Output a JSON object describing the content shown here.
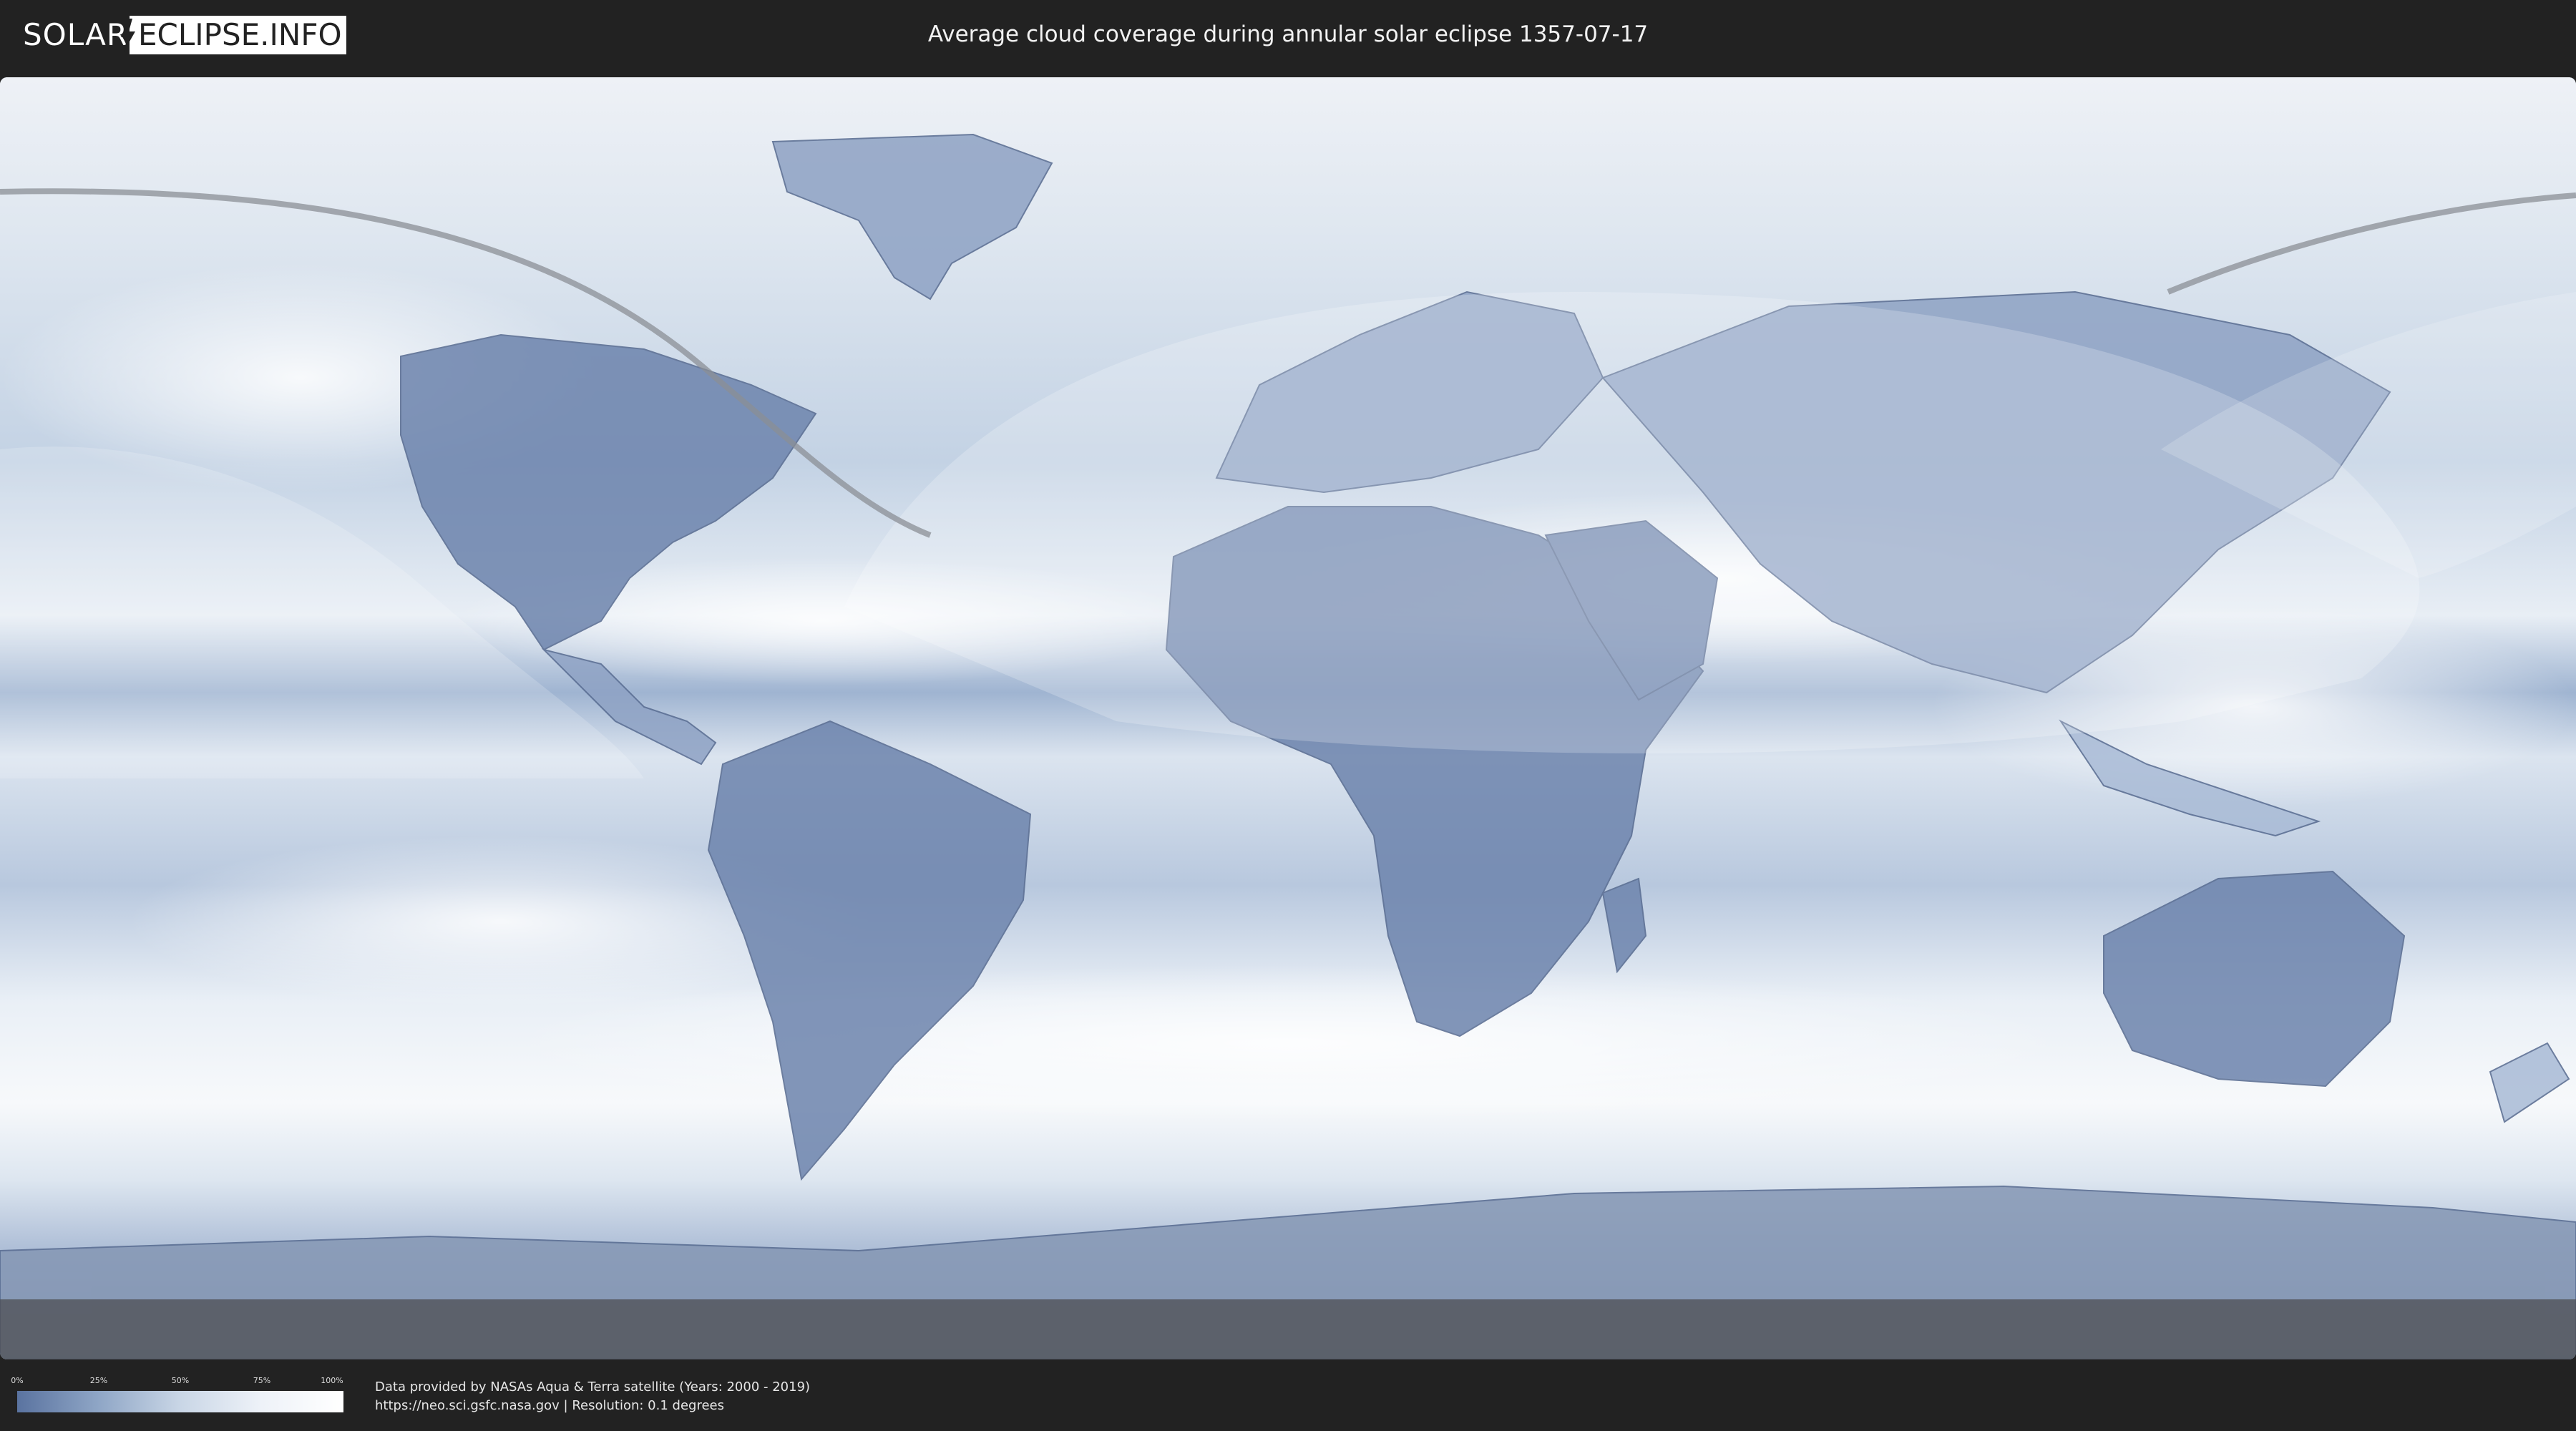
{
  "header": {
    "logo_left": "SOLAR",
    "logo_right": "ECLIPSE.INFO",
    "title": "Average cloud coverage during annular solar eclipse 1357-07-17"
  },
  "legend": {
    "ticks": [
      "0%",
      "25%",
      "50%",
      "75%",
      "100%"
    ],
    "colors": {
      "low": "#5a73a0",
      "high": "#ffffff"
    }
  },
  "credit": {
    "line1": "Data provided by NASAs Aqua & Terra satellite (Years: 2000 - 2019)",
    "line2": "https://neo.sci.gsfc.nasa.gov | Resolution: 0.1 degrees"
  },
  "map": {
    "icon": "world-cloud-map",
    "colors": {
      "ocean_clear": "#a9bdd8",
      "cloudy": "#f2f5f9",
      "land_clear": "#5f77a3",
      "shadow_overlay": "#ffffff",
      "eclipse_path": "#8b8f96"
    }
  }
}
